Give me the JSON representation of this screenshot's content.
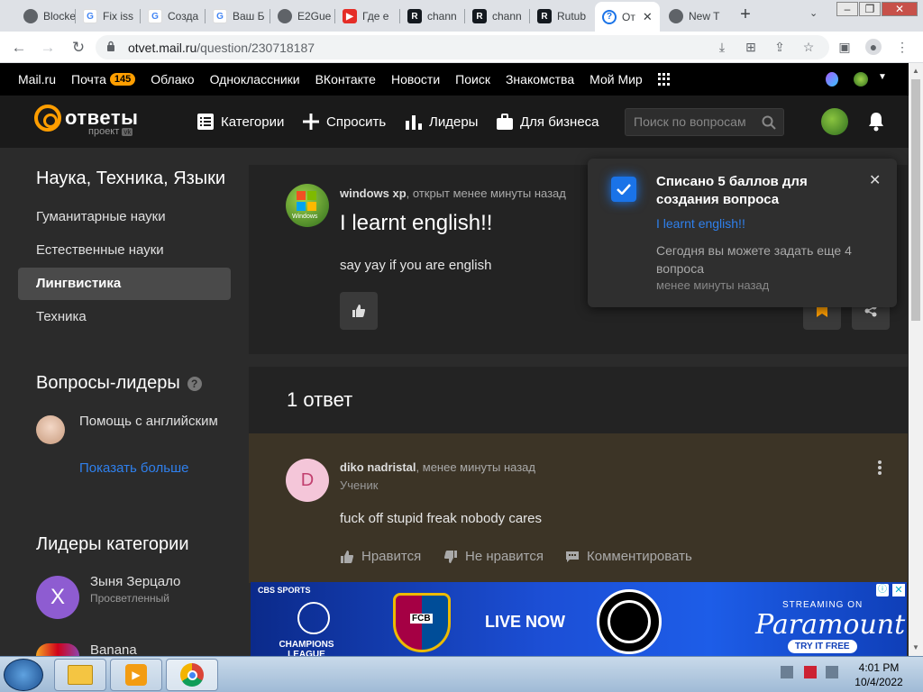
{
  "browser": {
    "tabs": [
      {
        "label": "Blocke",
        "icon": "globe-icon"
      },
      {
        "label": "Fix iss",
        "icon": "google-icon"
      },
      {
        "label": "Созда",
        "icon": "google-icon"
      },
      {
        "label": "Ваш Б",
        "icon": "google-icon"
      },
      {
        "label": "E2Gue",
        "icon": "globe-icon"
      },
      {
        "label": "Где е",
        "icon": "youtube-icon"
      },
      {
        "label": "chann",
        "icon": "rutube-icon"
      },
      {
        "label": "chann",
        "icon": "rutube-icon"
      },
      {
        "label": "Rutub",
        "icon": "rutube-icon"
      },
      {
        "label": "От",
        "icon": "otvet-icon",
        "active": true
      },
      {
        "label": "New T",
        "icon": "chrome-icon"
      }
    ],
    "url_host": "otvet.mail.ru",
    "url_path": "/question/230718187"
  },
  "mailbar": {
    "links": [
      "Mail.ru",
      "Почта",
      "Облако",
      "Одноклассники",
      "ВКонтакте",
      "Новости",
      "Поиск",
      "Знакомства",
      "Мой Мир"
    ],
    "mail_badge": "145"
  },
  "header": {
    "logo_text": "ответы",
    "logo_sub": "проект",
    "nav": [
      {
        "label": "Категории",
        "icon": "list-icon"
      },
      {
        "label": "Спросить",
        "icon": "plus-icon"
      },
      {
        "label": "Лидеры",
        "icon": "bar-chart-icon"
      },
      {
        "label": "Для бизнеса",
        "icon": "briefcase-icon"
      }
    ],
    "search_placeholder": "Поиск по вопросам"
  },
  "sidebar": {
    "category_title": "Наука, Техника, Языки",
    "categories": [
      "Гуманитарные науки",
      "Естественные науки",
      "Лингвистика",
      "Техника"
    ],
    "active_index": 2,
    "leaders_q_title": "Вопросы-лидеры",
    "leader_question": "Помощь с английским",
    "show_more": "Показать больше",
    "category_leaders_title": "Лидеры категории",
    "category_leaders": [
      {
        "name": "Зыня Зерцало",
        "rank": "Просветленный",
        "initial": "X"
      },
      {
        "name": "Banana",
        "rank": ""
      }
    ]
  },
  "question": {
    "author": "windows xp",
    "meta": ", открыт менее минуты назад",
    "avatar_text": "Windows",
    "title": "I learnt english!!",
    "body": "say yay if you are english"
  },
  "answers": {
    "count_label": "1 ответ",
    "items": [
      {
        "author": "diko nadristal",
        "meta": ", менее минуты назад",
        "rank": "Ученик",
        "initial": "D",
        "body": "fuck off stupid freak nobody cares",
        "like": "Нравится",
        "dislike": "Не нравится",
        "comment": "Комментировать"
      }
    ]
  },
  "toast": {
    "title": "Списано 5 баллов для создания вопроса",
    "link": "I learnt english!!",
    "text": "Сегодня вы можете задать еще 4 вопроса",
    "time": "менее минуты назад"
  },
  "ad": {
    "cbs": "CBS SPORTS",
    "ucl": "CHAMPIONS LEAGUE",
    "fcb": "FCB",
    "live": "LIVE NOW",
    "streaming": "STREAMING ON",
    "paramount": "Paramount+",
    "try": "TRY IT FREE"
  },
  "taskbar": {
    "time": "4:01 PM",
    "date": "10/4/2022"
  },
  "colors": {
    "accent_orange": "#ff9e00",
    "link_blue": "#2f80ed",
    "answer_bg": "#3c3426"
  }
}
